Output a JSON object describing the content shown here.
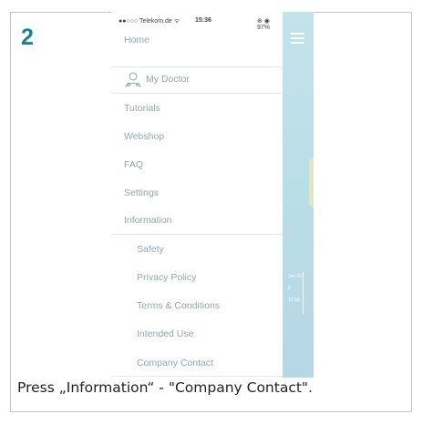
{
  "step": {
    "number": "2"
  },
  "status_bar": {
    "carrier": "●●○○○ Telekom.de ᯤ",
    "time": "15:36",
    "right": "⊕ ◉ 97%"
  },
  "menu": {
    "items": [
      {
        "label": "Home"
      },
      {
        "label": "My Doctor"
      },
      {
        "label": "Tutorials"
      },
      {
        "label": "Webshop"
      },
      {
        "label": "FAQ"
      },
      {
        "label": "Settings"
      },
      {
        "label": "Information"
      }
    ],
    "sub_items": [
      {
        "label": "Safety"
      },
      {
        "label": "Privacy Policy"
      },
      {
        "label": "Terms & Conditions"
      },
      {
        "label": "Intended Use"
      },
      {
        "label": "Company Contact"
      }
    ]
  },
  "side_panel": {
    "date_line_1": "Jan 13",
    "date_line_2": "2",
    "date_line_3": "12:58"
  },
  "caption": {
    "text": "Press „Information“ - \"Company Contact\"."
  },
  "colors": {
    "step_number": "#1f7f8c",
    "menu_text": "#8fa6b2",
    "side_panel": "#c3e3ea"
  }
}
